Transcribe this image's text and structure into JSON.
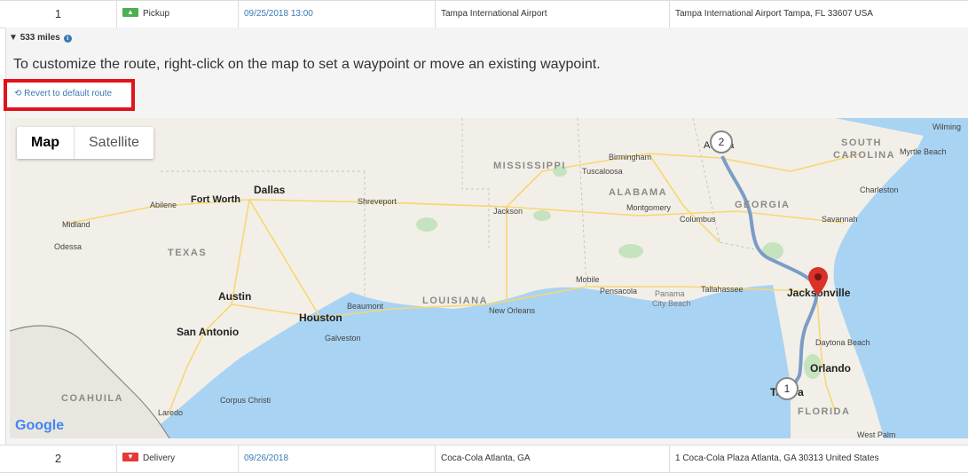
{
  "rows": [
    {
      "num": "1",
      "type": "Pickup",
      "type_icon": "arrow-up-icon",
      "date": "09/25/2018 13:00",
      "location": "Tampa International Airport",
      "address": "Tampa International Airport Tampa, FL 33607 USA"
    },
    {
      "num": "2",
      "type": "Delivery",
      "type_icon": "arrow-down-icon",
      "date": "09/26/2018",
      "location": "Coca-Cola Atlanta, GA",
      "address": "1 Coca-Cola Plaza Atlanta, GA 30313 United States"
    }
  ],
  "route": {
    "distance": "533 miles",
    "help_text": "To customize the route, right-click on the map to set a waypoint or move an existing waypoint.",
    "revert_label": "Revert to default route"
  },
  "map": {
    "type_map": "Map",
    "type_satellite": "Satellite",
    "attribution": "Google",
    "waypoint_1": "1",
    "waypoint_2": "2",
    "labels": {
      "wilming": "Wilming",
      "south": "SOUTH",
      "carolina": "CAROLINA",
      "myrtle_beach": "Myrtle Beach",
      "charleston": "Charleston",
      "atlanta": "Atlanta",
      "birmingham": "Birmingham",
      "tuscaloosa": "Tuscaloosa",
      "mississippi": "MISSISSIPPI",
      "alabama": "ALABAMA",
      "georgia": "GEORGIA",
      "montgomery": "Montgomery",
      "columbus": "Columbus",
      "savannah": "Savannah",
      "dallas": "Dallas",
      "fort_worth": "Fort Worth",
      "abilene": "Abilene",
      "shreveport": "Shreveport",
      "jackson": "Jackson",
      "midland": "Midland",
      "odessa": "Odessa",
      "texas": "TEXAS",
      "austin": "Austin",
      "houston": "Houston",
      "beaumont": "Beaumont",
      "louisiana": "LOUISIANA",
      "new_orleans": "New Orleans",
      "mobile": "Mobile",
      "pensacola": "Pensacola",
      "panama": "Panama",
      "city_beach": "City Beach",
      "tallahassee": "Tallahassee",
      "jacksonville": "Jacksonville",
      "san_antonio": "San Antonio",
      "galveston": "Galveston",
      "daytona_beach": "Daytona Beach",
      "orlando": "Orlando",
      "tampa": "Tampa",
      "florida": "FLORIDA",
      "coahuila": "COAHUILA",
      "corpus_christi": "Corpus Christi",
      "laredo": "Laredo",
      "west_palm": "West Palm"
    }
  },
  "colors": {
    "water": "#a9d3f2",
    "land": "#f2efe8",
    "route": "#7b9cc4",
    "highway": "#f7d774",
    "link": "#3a78b5",
    "highlight": "#e0131b",
    "pin": "#d9322a"
  }
}
